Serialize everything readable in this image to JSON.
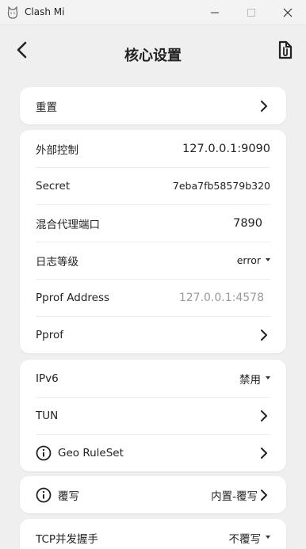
{
  "window": {
    "title": "Clash Mi"
  },
  "header": {
    "title": "核心设置"
  },
  "card1": {
    "reset_label": "重置"
  },
  "card2": {
    "external_control_label": "外部控制",
    "external_control_value": "127.0.0.1:9090",
    "secret_label": "Secret",
    "secret_value": "7eba7fb58579b320",
    "mixed_port_label": "混合代理端口",
    "mixed_port_value": "7890",
    "log_level_label": "日志等级",
    "log_level_value": "error",
    "pprof_address_label": "Pprof Address",
    "pprof_address_value": "127.0.0.1:4578",
    "pprof_label": "Pprof"
  },
  "card3": {
    "ipv6_label": "IPv6",
    "ipv6_value": "禁用",
    "tun_label": "TUN",
    "geo_ruleset_label": "Geo RuleSet"
  },
  "card4": {
    "override_label": "覆写",
    "override_value": "内置-覆写"
  },
  "card5": {
    "tcp_concurrent_label": "TCP并发握手",
    "tcp_concurrent_value": "不覆写"
  },
  "icons": {
    "app": "cat-icon",
    "back": "back-arrow-icon",
    "file": "file-attachment-icon",
    "info": "info-icon",
    "chevron": "chevron-right-icon"
  }
}
